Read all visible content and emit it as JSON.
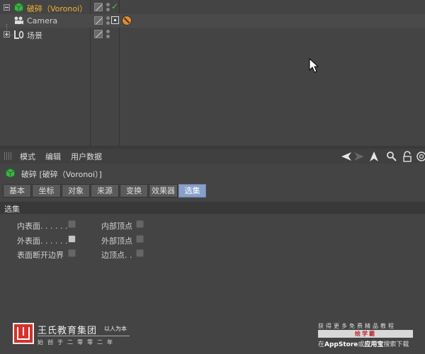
{
  "object_manager": {
    "objects": [
      {
        "label": "破碎（Voronoi）",
        "icon": "voronoi-fracture-icon",
        "active": true,
        "status": "check-mark"
      },
      {
        "label": "Camera",
        "icon": "camera-icon",
        "active": false,
        "tag_icon": "protection-tag-icon"
      },
      {
        "label": "场景",
        "icon": "null-scene-icon",
        "active": false
      }
    ],
    "accent_color": "#f2b233"
  },
  "attribute_manager": {
    "menu": [
      "模式",
      "编辑",
      "用户数据"
    ],
    "object_title": "破碎 [破碎（Voronoi）]",
    "tabs": [
      "基本",
      "坐标",
      "对象",
      "来源",
      "变换",
      "效果器",
      "选集"
    ],
    "active_tab": "选集",
    "section_title": "选集",
    "options_left": [
      {
        "label": "内表面. . . . . .",
        "checked": false
      },
      {
        "label": "外表面. . . . . .",
        "checked": false
      },
      {
        "label": "表面断开边界",
        "checked": false
      }
    ],
    "options_right": [
      {
        "label": "内部顶点",
        "checked": false
      },
      {
        "label": "外部顶点",
        "checked": false
      },
      {
        "label": "边顶点. .",
        "checked": false
      }
    ],
    "tab_active_color": "#88a0c8"
  },
  "watermark": {
    "brand_name": "王氏教育集团",
    "slogan": "以人为本",
    "sub": "始创于二零零二年",
    "promo_top": "获得更多免费精品教程",
    "promo_bar": "绘学霸",
    "promo_bottom_prefix": "在",
    "promo_bottom_store1": "AppStore",
    "promo_bottom_mid": "或",
    "promo_bottom_store2": "应用宝",
    "promo_bottom_suffix": "搜索下载"
  }
}
